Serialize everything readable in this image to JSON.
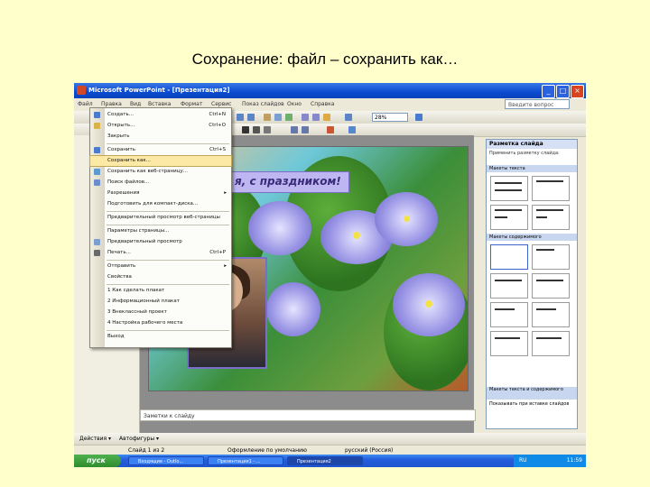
{
  "slide_title": "Сохранение: файл – сохранить как…",
  "window": {
    "title": "Microsoft PowerPoint - [Презентация2]",
    "minimize": "_",
    "maximize": "□",
    "close": "×"
  },
  "menubar": {
    "items": [
      "Файл",
      "Правка",
      "Вид",
      "Вставка",
      "Формат",
      "Сервис",
      "Показ слайдов",
      "Окно",
      "Справка"
    ],
    "help_placeholder": "Введите вопрос"
  },
  "toolbar": {
    "zoom": "28%"
  },
  "slide": {
    "caption": "я, с праздником!"
  },
  "notes": {
    "placeholder": "Заметки к слайду"
  },
  "taskpane": {
    "title": "Разметка слайда",
    "subtitle": "Применить разметку слайда:",
    "sections": [
      "Макеты текста",
      "Макеты содержимого",
      "Макеты текста и содержимого"
    ],
    "footer": "Показывать при вставке слайдов"
  },
  "file_menu": {
    "items": [
      {
        "label": "Создать...",
        "shortcut": "Ctrl+N"
      },
      {
        "label": "Открыть...",
        "shortcut": "Ctrl+O"
      },
      {
        "label": "Закрыть",
        "shortcut": ""
      },
      {
        "label": "Сохранить",
        "shortcut": "Ctrl+S"
      },
      {
        "label": "Сохранить как...",
        "shortcut": ""
      },
      {
        "label": "Сохранить как веб-страницу...",
        "shortcut": ""
      },
      {
        "label": "Поиск файлов...",
        "shortcut": ""
      },
      {
        "label": "Разрешения",
        "shortcut": ""
      },
      {
        "label": "Подготовить для компакт-диска...",
        "shortcut": ""
      },
      {
        "label": "Предварительный просмотр веб-страницы",
        "shortcut": ""
      },
      {
        "label": "Параметры страницы...",
        "shortcut": ""
      },
      {
        "label": "Предварительный просмотр",
        "shortcut": ""
      },
      {
        "label": "Печать...",
        "shortcut": "Ctrl+P"
      },
      {
        "label": "Отправить",
        "shortcut": ""
      },
      {
        "label": "Свойства",
        "shortcut": ""
      },
      {
        "label": "1 Как сделать плакат",
        "shortcut": ""
      },
      {
        "label": "2 Информационный плакат",
        "shortcut": ""
      },
      {
        "label": "3 Внеклассный проект",
        "shortcut": ""
      },
      {
        "label": "4 Настройка рабочего места",
        "shortcut": ""
      },
      {
        "label": "Выход",
        "shortcut": ""
      }
    ],
    "submenu_arrow": "▸"
  },
  "drawbar": {
    "actions": "Действия ▾",
    "autoshapes": "Автофигуры ▾"
  },
  "statusbar": {
    "slide": "Слайд 1 из 2",
    "design": "Оформление по умолчанию",
    "lang": "русский (Россия)"
  },
  "taskbar": {
    "start": "пуск",
    "tasks": [
      "Входящие - Outlo...",
      "Презентация1 - ...",
      "Презентация2"
    ],
    "lang": "RU",
    "clock": "11:59"
  }
}
